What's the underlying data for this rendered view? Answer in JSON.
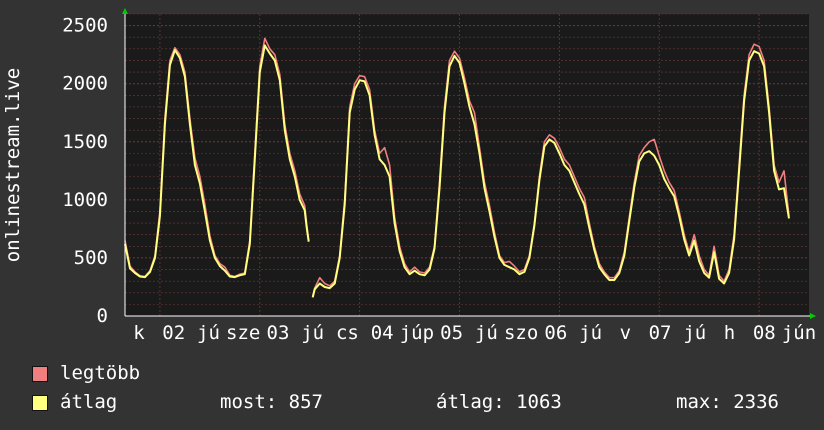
{
  "chart_data": {
    "type": "line",
    "ylabel": "onlinestream.live",
    "ylim": [
      0,
      2600
    ],
    "y_ticks": [
      0,
      500,
      1000,
      1500,
      2000,
      2500
    ],
    "x_tick_labels": [
      "k",
      "02",
      "jú",
      "sze",
      "03",
      "jú",
      "cs",
      "04",
      "júp",
      "05",
      "jú",
      "szo",
      "06",
      "jú",
      "v",
      "07",
      "jú",
      "h",
      "08",
      "jún"
    ],
    "x_range": [
      0,
      6.85
    ],
    "series": [
      {
        "name": "legtöbb",
        "color": "#f07f7f",
        "segments": [
          [
            [
              0,
              650
            ],
            [
              0.05,
              430
            ],
            [
              0.1,
              380
            ],
            [
              0.15,
              345
            ],
            [
              0.2,
              340
            ],
            [
              0.25,
              390
            ],
            [
              0.3,
              520
            ],
            [
              0.35,
              900
            ],
            [
              0.4,
              1700
            ],
            [
              0.45,
              2200
            ],
            [
              0.5,
              2310
            ],
            [
              0.55,
              2250
            ],
            [
              0.6,
              2100
            ],
            [
              0.65,
              1700
            ],
            [
              0.7,
              1360
            ],
            [
              0.75,
              1200
            ],
            [
              0.8,
              960
            ],
            [
              0.85,
              690
            ],
            [
              0.9,
              520
            ],
            [
              0.95,
              450
            ],
            [
              1.0,
              420
            ],
            [
              1.05,
              350
            ],
            [
              1.1,
              340
            ],
            [
              1.15,
              360
            ],
            [
              1.2,
              370
            ],
            [
              1.25,
              650
            ],
            [
              1.3,
              1400
            ],
            [
              1.35,
              2150
            ],
            [
              1.4,
              2390
            ],
            [
              1.45,
              2300
            ],
            [
              1.5,
              2250
            ],
            [
              1.55,
              2080
            ],
            [
              1.6,
              1650
            ],
            [
              1.65,
              1400
            ],
            [
              1.7,
              1250
            ],
            [
              1.75,
              1050
            ],
            [
              1.8,
              950
            ],
            [
              1.82,
              790
            ],
            [
              1.84,
              650
            ]
          ],
          [
            [
              1.88,
              170
            ],
            [
              1.9,
              240
            ],
            [
              1.95,
              330
            ],
            [
              2.0,
              280
            ],
            [
              2.05,
              260
            ],
            [
              2.1,
              300
            ],
            [
              2.15,
              520
            ],
            [
              2.2,
              1000
            ],
            [
              2.25,
              1800
            ],
            [
              2.3,
              2000
            ],
            [
              2.35,
              2070
            ],
            [
              2.4,
              2060
            ],
            [
              2.45,
              1950
            ],
            [
              2.5,
              1600
            ],
            [
              2.55,
              1400
            ],
            [
              2.6,
              1450
            ],
            [
              2.65,
              1300
            ],
            [
              2.7,
              850
            ],
            [
              2.75,
              600
            ],
            [
              2.8,
              450
            ],
            [
              2.85,
              380
            ],
            [
              2.9,
              420
            ],
            [
              2.95,
              380
            ],
            [
              3.0,
              370
            ],
            [
              3.05,
              420
            ],
            [
              3.1,
              600
            ],
            [
              3.15,
              1150
            ],
            [
              3.2,
              1800
            ],
            [
              3.25,
              2200
            ],
            [
              3.3,
              2280
            ],
            [
              3.35,
              2220
            ],
            [
              3.4,
              2050
            ],
            [
              3.45,
              1850
            ],
            [
              3.5,
              1750
            ],
            [
              3.55,
              1450
            ],
            [
              3.6,
              1150
            ],
            [
              3.65,
              950
            ],
            [
              3.7,
              720
            ],
            [
              3.75,
              520
            ],
            [
              3.8,
              460
            ],
            [
              3.85,
              470
            ],
            [
              3.9,
              430
            ],
            [
              3.95,
              380
            ],
            [
              4.0,
              400
            ],
            [
              4.05,
              520
            ],
            [
              4.1,
              800
            ],
            [
              4.15,
              1200
            ],
            [
              4.2,
              1500
            ],
            [
              4.25,
              1560
            ],
            [
              4.3,
              1530
            ],
            [
              4.35,
              1450
            ],
            [
              4.4,
              1350
            ],
            [
              4.45,
              1300
            ],
            [
              4.5,
              1200
            ],
            [
              4.55,
              1100
            ],
            [
              4.6,
              1020
            ],
            [
              4.65,
              800
            ],
            [
              4.7,
              600
            ],
            [
              4.75,
              450
            ],
            [
              4.8,
              380
            ],
            [
              4.85,
              330
            ],
            [
              4.9,
              330
            ],
            [
              4.95,
              390
            ],
            [
              5.0,
              550
            ],
            [
              5.05,
              850
            ],
            [
              5.1,
              1150
            ],
            [
              5.15,
              1380
            ],
            [
              5.2,
              1450
            ],
            [
              5.25,
              1500
            ],
            [
              5.3,
              1520
            ],
            [
              5.35,
              1380
            ],
            [
              5.4,
              1250
            ],
            [
              5.45,
              1150
            ],
            [
              5.5,
              1080
            ],
            [
              5.55,
              900
            ],
            [
              5.6,
              700
            ],
            [
              5.65,
              550
            ],
            [
              5.7,
              700
            ],
            [
              5.75,
              520
            ],
            [
              5.8,
              400
            ],
            [
              5.85,
              350
            ],
            [
              5.9,
              600
            ],
            [
              5.95,
              350
            ],
            [
              6.0,
              300
            ],
            [
              6.05,
              400
            ],
            [
              6.1,
              700
            ],
            [
              6.15,
              1300
            ],
            [
              6.2,
              1900
            ],
            [
              6.25,
              2250
            ],
            [
              6.3,
              2340
            ],
            [
              6.35,
              2320
            ],
            [
              6.4,
              2200
            ],
            [
              6.45,
              1800
            ],
            [
              6.5,
              1300
            ],
            [
              6.55,
              1150
            ],
            [
              6.6,
              1250
            ],
            [
              6.65,
              860
            ]
          ]
        ]
      },
      {
        "name": "átlag",
        "color": "#ffff80",
        "segments": [
          [
            [
              0,
              620
            ],
            [
              0.05,
              410
            ],
            [
              0.1,
              370
            ],
            [
              0.15,
              340
            ],
            [
              0.2,
              335
            ],
            [
              0.25,
              380
            ],
            [
              0.3,
              500
            ],
            [
              0.35,
              860
            ],
            [
              0.4,
              1650
            ],
            [
              0.45,
              2160
            ],
            [
              0.5,
              2290
            ],
            [
              0.55,
              2220
            ],
            [
              0.6,
              2060
            ],
            [
              0.65,
              1650
            ],
            [
              0.7,
              1300
            ],
            [
              0.75,
              1140
            ],
            [
              0.8,
              900
            ],
            [
              0.85,
              650
            ],
            [
              0.9,
              500
            ],
            [
              0.95,
              430
            ],
            [
              1.0,
              390
            ],
            [
              1.05,
              340
            ],
            [
              1.1,
              335
            ],
            [
              1.15,
              350
            ],
            [
              1.2,
              360
            ],
            [
              1.25,
              620
            ],
            [
              1.3,
              1350
            ],
            [
              1.35,
              2100
            ],
            [
              1.4,
              2330
            ],
            [
              1.45,
              2260
            ],
            [
              1.5,
              2200
            ],
            [
              1.55,
              2030
            ],
            [
              1.6,
              1600
            ],
            [
              1.65,
              1350
            ],
            [
              1.7,
              1200
            ],
            [
              1.75,
              1000
            ],
            [
              1.8,
              910
            ],
            [
              1.82,
              760
            ],
            [
              1.84,
              640
            ]
          ],
          [
            [
              1.88,
              160
            ],
            [
              1.9,
              230
            ],
            [
              1.95,
              280
            ],
            [
              2.0,
              250
            ],
            [
              2.05,
              240
            ],
            [
              2.1,
              280
            ],
            [
              2.15,
              500
            ],
            [
              2.2,
              960
            ],
            [
              2.25,
              1750
            ],
            [
              2.3,
              1950
            ],
            [
              2.35,
              2030
            ],
            [
              2.4,
              2020
            ],
            [
              2.45,
              1900
            ],
            [
              2.5,
              1560
            ],
            [
              2.55,
              1350
            ],
            [
              2.6,
              1300
            ],
            [
              2.65,
              1200
            ],
            [
              2.7,
              800
            ],
            [
              2.75,
              560
            ],
            [
              2.8,
              420
            ],
            [
              2.85,
              360
            ],
            [
              2.9,
              390
            ],
            [
              2.95,
              360
            ],
            [
              3.0,
              350
            ],
            [
              3.05,
              400
            ],
            [
              3.1,
              580
            ],
            [
              3.15,
              1100
            ],
            [
              3.2,
              1750
            ],
            [
              3.25,
              2150
            ],
            [
              3.3,
              2240
            ],
            [
              3.35,
              2180
            ],
            [
              3.4,
              2000
            ],
            [
              3.45,
              1800
            ],
            [
              3.5,
              1650
            ],
            [
              3.55,
              1400
            ],
            [
              3.6,
              1100
            ],
            [
              3.65,
              900
            ],
            [
              3.7,
              680
            ],
            [
              3.75,
              500
            ],
            [
              3.8,
              440
            ],
            [
              3.85,
              420
            ],
            [
              3.9,
              400
            ],
            [
              3.95,
              360
            ],
            [
              4.0,
              380
            ],
            [
              4.05,
              500
            ],
            [
              4.1,
              780
            ],
            [
              4.15,
              1170
            ],
            [
              4.2,
              1460
            ],
            [
              4.25,
              1520
            ],
            [
              4.3,
              1490
            ],
            [
              4.35,
              1400
            ],
            [
              4.4,
              1300
            ],
            [
              4.45,
              1250
            ],
            [
              4.5,
              1150
            ],
            [
              4.55,
              1050
            ],
            [
              4.6,
              960
            ],
            [
              4.65,
              760
            ],
            [
              4.7,
              570
            ],
            [
              4.75,
              420
            ],
            [
              4.8,
              360
            ],
            [
              4.85,
              310
            ],
            [
              4.9,
              310
            ],
            [
              4.95,
              370
            ],
            [
              5.0,
              520
            ],
            [
              5.05,
              820
            ],
            [
              5.1,
              1110
            ],
            [
              5.15,
              1330
            ],
            [
              5.2,
              1400
            ],
            [
              5.25,
              1420
            ],
            [
              5.3,
              1380
            ],
            [
              5.35,
              1300
            ],
            [
              5.4,
              1180
            ],
            [
              5.45,
              1100
            ],
            [
              5.5,
              1030
            ],
            [
              5.55,
              860
            ],
            [
              5.6,
              660
            ],
            [
              5.65,
              520
            ],
            [
              5.7,
              650
            ],
            [
              5.75,
              470
            ],
            [
              5.8,
              370
            ],
            [
              5.85,
              330
            ],
            [
              5.9,
              550
            ],
            [
              5.95,
              320
            ],
            [
              6.0,
              280
            ],
            [
              6.05,
              370
            ],
            [
              6.1,
              660
            ],
            [
              6.15,
              1250
            ],
            [
              6.2,
              1850
            ],
            [
              6.25,
              2200
            ],
            [
              6.3,
              2280
            ],
            [
              6.35,
              2260
            ],
            [
              6.4,
              2150
            ],
            [
              6.45,
              1750
            ],
            [
              6.5,
              1250
            ],
            [
              6.55,
              1090
            ],
            [
              6.6,
              1100
            ],
            [
              6.65,
              840
            ]
          ]
        ]
      }
    ]
  },
  "legend": {
    "max_label": "legtöbb",
    "avg_label": "átlag",
    "now_text": "most: 857",
    "avg_text": "átlag: 1063",
    "max_text": "max: 2336"
  },
  "colors": {
    "background": "#333333",
    "plot_background": "#1a1a1a",
    "grid": "#6b3a3a",
    "max_series": "#f07f7f",
    "avg_series": "#ffff80",
    "axis": "#ffffff",
    "axis_arrow": "#00cc00"
  }
}
